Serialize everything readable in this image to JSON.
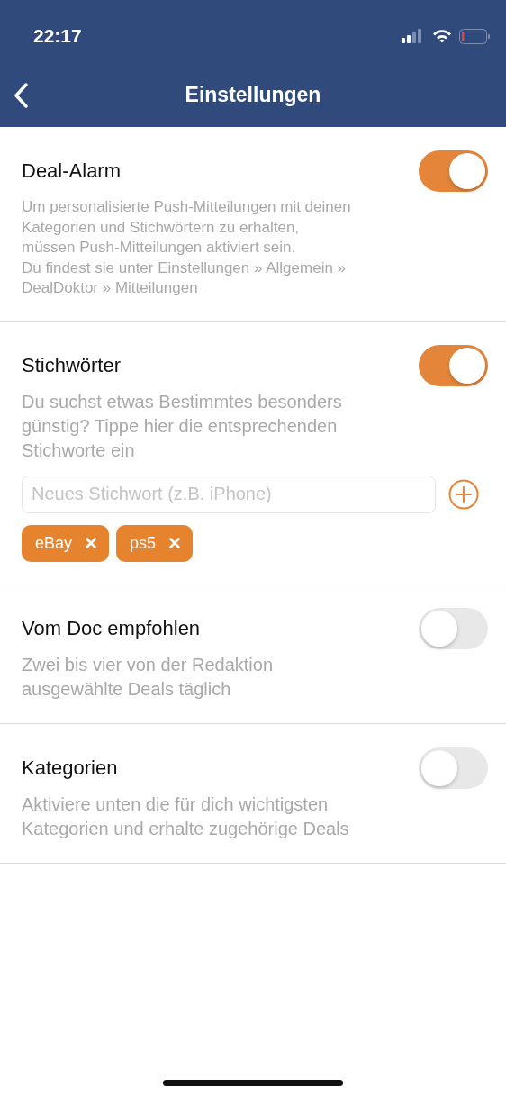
{
  "status_bar": {
    "time": "22:17"
  },
  "nav": {
    "title": "Einstellungen"
  },
  "sections": [
    {
      "title": "Deal-Alarm",
      "on": true,
      "small": true,
      "description": "Um personalisierte Push-Mitteilungen mit deinen\nKategorien und Stichwörtern zu erhalten,\nmüssen Push-Mitteilungen aktiviert sein.\nDu findest sie unter Einstellungen » Allgemein »\nDealDoktor » Mitteilungen"
    },
    {
      "title": "Stichwörter",
      "on": true,
      "small": false,
      "description": "Du suchst etwas Bestimmtes besonders\ngünstig? Tippe hier die entsprechenden\nStichworte ein",
      "keyword_field": {
        "placeholder": "Neues Stichwort (z.B. iPhone)"
      },
      "tags": [
        "eBay",
        "ps5"
      ]
    },
    {
      "title": "Vom Doc empfohlen",
      "on": false,
      "small": false,
      "description": "Zwei bis vier von der Redaktion\nausgewählte Deals täglich"
    },
    {
      "title": "Kategorien",
      "on": false,
      "small": false,
      "description": "Aktiviere unten die für dich wichtigsten\nKategorien und erhalte zugehörige Deals"
    }
  ]
}
